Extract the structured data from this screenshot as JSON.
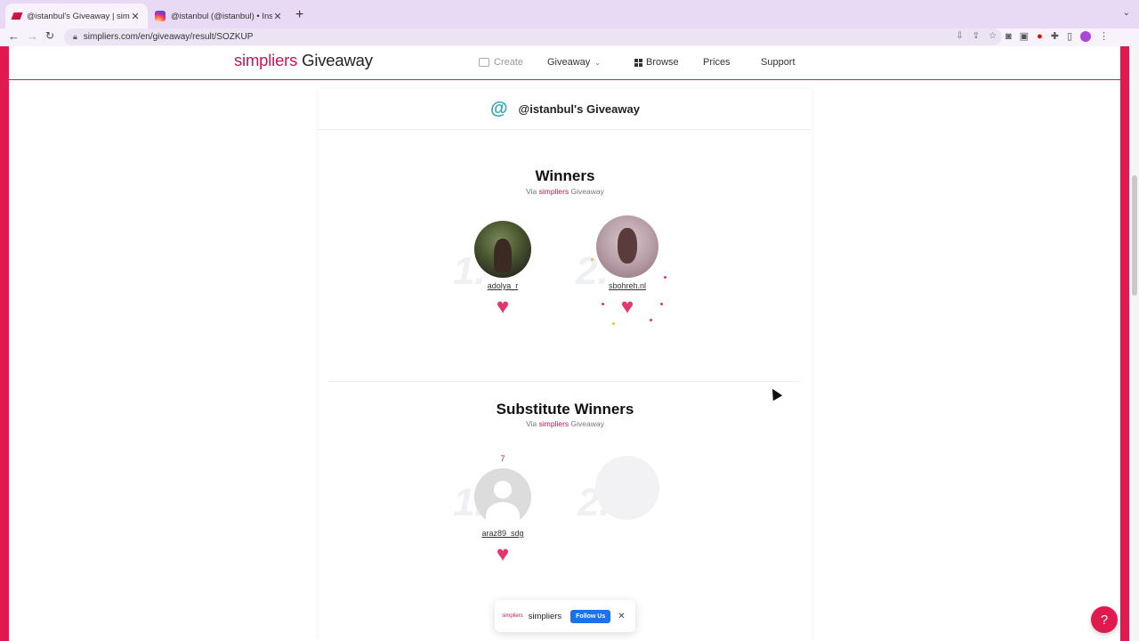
{
  "browser": {
    "tabs": [
      {
        "title": "@istanbul's Giveaway | simpli",
        "active": true
      },
      {
        "title": "@istanbul (@istanbul) • Instag",
        "active": false
      }
    ],
    "url": "simpliers.com/en/giveaway/result/SOZKUP"
  },
  "site": {
    "logo_brand": "simpliers",
    "logo_rest": " Giveaway",
    "nav": {
      "create": "Create",
      "giveaway": "Giveaway",
      "browse": "Browse",
      "prices": "Prices",
      "support": "Support"
    }
  },
  "card": {
    "title": "@istanbul's Giveaway",
    "winners": {
      "title": "Winners",
      "via_prefix": "Via ",
      "via_brand": "simpliers",
      "via_suffix": " Giveaway",
      "items": [
        {
          "rank": "1.",
          "username": "adolya_r"
        },
        {
          "rank": "2.",
          "username": "sbohreh.nl"
        }
      ]
    },
    "substitutes": {
      "title": "Substitute Winners",
      "via_prefix": "Via ",
      "via_brand": "simpliers",
      "via_suffix": " Giveaway",
      "items": [
        {
          "rank": "1.",
          "username": "araz89_sdg",
          "count": "7"
        },
        {
          "rank": "2.",
          "username": ""
        }
      ]
    }
  },
  "help_label": "?",
  "follow": {
    "brand": "simpliers",
    "name": "simpliers",
    "button": "Follow Us",
    "close": "✕"
  },
  "colors": {
    "brand": "#e0194f",
    "heart": "#e6346d",
    "follow_button": "#1a73e8"
  }
}
